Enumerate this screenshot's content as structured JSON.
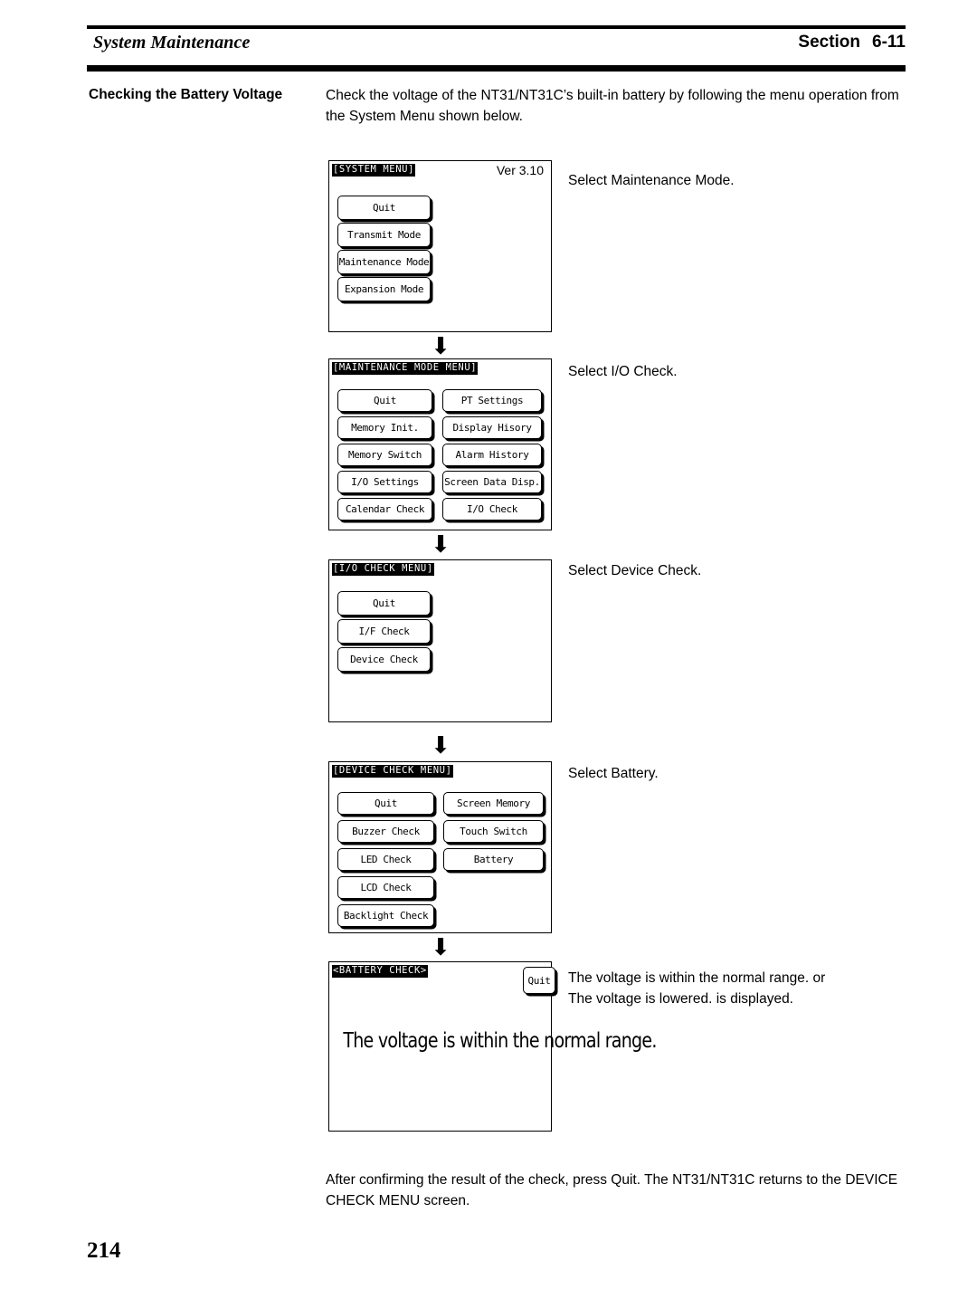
{
  "header": {
    "left_title": "System Maintenance",
    "right_label": "Section",
    "section_number": "6-11"
  },
  "body": {
    "side_heading": "Checking the Battery Voltage",
    "intro_paragraph": "Check the voltage of the NT31/NT31C’s built-in battery by following the menu operation from the System Menu shown below.",
    "outro_paragraph": "After confirming the result of the check, press Quit. The NT31/NT31C returns to the DEVICE CHECK MENU screen.",
    "page_number": "214"
  },
  "flow": {
    "arrow_glyph": "⬇",
    "screens": [
      {
        "id": "system-menu",
        "title": "[SYSTEM MENU]",
        "version": "Ver 3.10",
        "annotation": "Select Maintenance Mode.",
        "buttons_left": [
          "Quit",
          "Transmit Mode",
          "Maintenance Mode",
          "Expansion Mode"
        ],
        "buttons_right": []
      },
      {
        "id": "maintenance-mode-menu",
        "title": "[MAINTENANCE MODE MENU]",
        "version": "",
        "annotation": "Select I/O Check.",
        "buttons_left": [
          "Quit",
          "Memory Init.",
          "Memory Switch",
          "I/O Settings",
          "Calendar Check"
        ],
        "buttons_right": [
          "PT Settings",
          "Display Hisory",
          "Alarm History",
          "Screen Data Disp.",
          "I/O Check"
        ]
      },
      {
        "id": "io-check-menu",
        "title": "[I/O CHECK MENU]",
        "version": "",
        "annotation": "Select Device Check.",
        "buttons_left": [
          "Quit",
          "I/F Check",
          "Device Check"
        ],
        "buttons_right": []
      },
      {
        "id": "device-check-menu",
        "title": "[DEVICE CHECK MENU]",
        "version": "",
        "annotation": "Select Battery.",
        "buttons_left": [
          "Quit",
          "Buzzer Check",
          "LED Check",
          "LCD Check",
          "Backlight Check"
        ],
        "buttons_right": [
          "Screen Memory",
          "Touch Switch",
          "Battery"
        ]
      },
      {
        "id": "battery-check",
        "title": "<BATTERY CHECK>",
        "version": "",
        "quit_label": "Quit",
        "message": "The voltage is within the normal range.",
        "annotation_line1": "The voltage is within the normal range. or",
        "annotation_line2": "The voltage is lowered. is displayed."
      }
    ]
  }
}
